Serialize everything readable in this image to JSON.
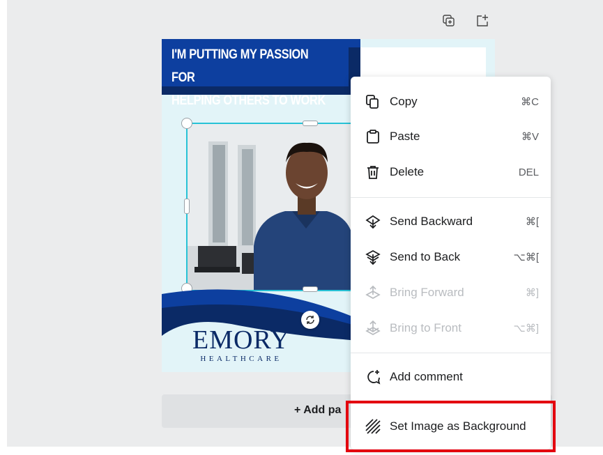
{
  "toolbar": {
    "duplicate_icon": "duplicate-page-icon",
    "add_icon": "add-page-icon"
  },
  "design": {
    "headline": "I'M PUTTING MY PASSION FOR\nHELPING OTHERS TO WORK",
    "logo_main": "EMORY",
    "logo_sub": "HEALTHCARE",
    "colors": {
      "navy": "#0b2a66",
      "blue": "#0d3f9f",
      "background": "#e2f4f8",
      "selection": "#27c2d6"
    }
  },
  "add_page": {
    "label": "+ Add pa"
  },
  "context_menu": {
    "items": [
      {
        "label": "Copy",
        "shortcut": "⌘C",
        "icon": "copy-icon",
        "enabled": true
      },
      {
        "label": "Paste",
        "shortcut": "⌘V",
        "icon": "paste-icon",
        "enabled": true
      },
      {
        "label": "Delete",
        "shortcut": "DEL",
        "icon": "trash-icon",
        "enabled": true
      },
      {
        "label": "Send Backward",
        "shortcut": "⌘[",
        "icon": "send-backward-icon",
        "enabled": true
      },
      {
        "label": "Send to Back",
        "shortcut": "⌥⌘[",
        "icon": "send-to-back-icon",
        "enabled": true
      },
      {
        "label": "Bring Forward",
        "shortcut": "⌘]",
        "icon": "bring-forward-icon",
        "enabled": false
      },
      {
        "label": "Bring to Front",
        "shortcut": "⌥⌘]",
        "icon": "bring-to-front-icon",
        "enabled": false
      },
      {
        "label": "Add comment",
        "shortcut": "",
        "icon": "comment-icon",
        "enabled": true
      },
      {
        "label": "Set Image as Background",
        "shortcut": "",
        "icon": "background-icon",
        "enabled": true
      }
    ]
  },
  "highlight_color": "#e3000f"
}
